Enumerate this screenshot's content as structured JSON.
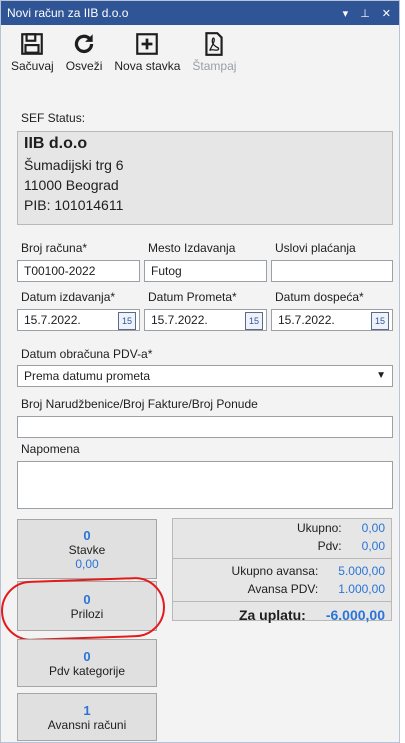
{
  "window": {
    "title": "Novi račun za IIB d.o.o"
  },
  "toolbar": {
    "items": [
      {
        "label": "Sačuvaj",
        "icon": "save-icon"
      },
      {
        "label": "Osveži",
        "icon": "refresh-icon"
      },
      {
        "label": "Nova stavka",
        "icon": "add-icon"
      },
      {
        "label": "Štampaj",
        "icon": "print-pdf-icon",
        "disabled": true
      }
    ]
  },
  "sef_status": {
    "label": "SEF Status:"
  },
  "company": {
    "name": "IIB d.o.o",
    "street": "Šumadijski trg 6",
    "city": "11000 Beograd",
    "pib": "PIB:  101014611"
  },
  "fields": {
    "broj_racuna": {
      "label": "Broj računa*",
      "value": "T00100-2022"
    },
    "mesto_izdavanja": {
      "label": "Mesto Izdavanja",
      "value": "Futog"
    },
    "uslovi_placanja": {
      "label": "Uslovi plaćanja",
      "value": ""
    },
    "datum_izdavanja": {
      "label": "Datum izdavanja*",
      "value": "15.7.2022."
    },
    "datum_prometa": {
      "label": "Datum Prometa*",
      "value": "15.7.2022."
    },
    "datum_dospeca": {
      "label": "Datum dospeća*",
      "value": "15.7.2022."
    },
    "datum_obracuna_pdv": {
      "label": "Datum obračuna PDV-a*",
      "value": "Prema datumu prometa"
    },
    "broj_narudzbenice": {
      "label": "Broj Narudžbenice/Broj Fakture/Broj Ponude",
      "value": ""
    },
    "napomena": {
      "label": "Napomena",
      "value": ""
    }
  },
  "calendar_icon_text": "15",
  "buttons": {
    "stavke": {
      "count": "0",
      "label": "Stavke",
      "sub": "0,00"
    },
    "prilozi": {
      "count": "0",
      "label": "Prilozi"
    },
    "pdv_kategorije": {
      "count": "0",
      "label": "Pdv kategorije"
    },
    "avansni_racuni": {
      "count": "1",
      "label": "Avansni računi"
    }
  },
  "totals": {
    "ukupno": {
      "label": "Ukupno:",
      "value": "0,00"
    },
    "pdv": {
      "label": "Pdv:",
      "value": "0,00"
    },
    "ukupno_avansa": {
      "label": "Ukupno avansa:",
      "value": "5.000,00"
    },
    "avansa_pdv": {
      "label": "Avansa PDV:",
      "value": "1.000,00"
    },
    "za_uplatu": {
      "label": "Za uplatu:",
      "value": "-6.000,00"
    }
  },
  "colors": {
    "titlebar": "#2f5597",
    "accent": "#2b74d8",
    "annotation": "#e41a1c"
  }
}
